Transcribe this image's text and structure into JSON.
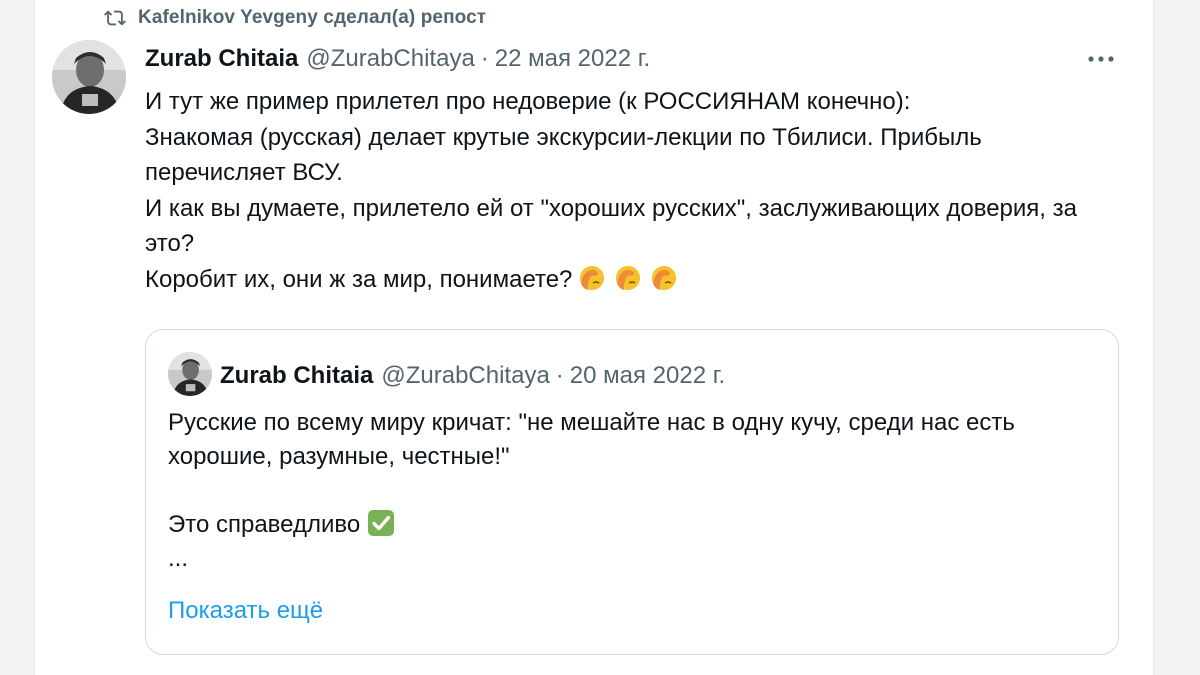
{
  "repost": {
    "icon": "repost-icon",
    "text": "Kafelnikov Yevgeny сделал(а) репост"
  },
  "tweet": {
    "author_name": "Zurab Chitaia",
    "handle": "@ZurabChitaya",
    "separator": "·",
    "date": "22 мая 2022 г.",
    "lines": [
      "И тут же пример прилетел про недоверие (к РОССИЯНАМ конечно):",
      "Знакомая (русская) делает крутые экскурсии-лекции по Тбилиси. Прибыль перечисляет ВСУ.",
      "И как вы думаете, прилетело ей от \"хороших русских\", заслуживающих доверия, за это?",
      "Коробит их, они ж за мир, понимаете?"
    ],
    "emojis": [
      "facepalm-emoji",
      "facepalm-emoji",
      "facepalm-emoji"
    ],
    "more_icon": "more-options-icon"
  },
  "quote": {
    "author_name": "Zurab Chitaia",
    "handle": "@ZurabChitaya",
    "separator": "·",
    "date": "20 мая 2022 г.",
    "line1": "Русские по всему миру кричат: \"не мешайте нас в одну кучу, среди нас есть хорошие, разумные, честные!\"",
    "line2": "Это справедливо",
    "line2_emoji": "check-mark-emoji",
    "ellipsis": "...",
    "show_more": "Показать ещё"
  },
  "colors": {
    "text_primary": "#0f1419",
    "text_secondary": "#536471",
    "link": "#1d9bf0",
    "border": "#cfd9de",
    "check_green": "#77b255"
  }
}
